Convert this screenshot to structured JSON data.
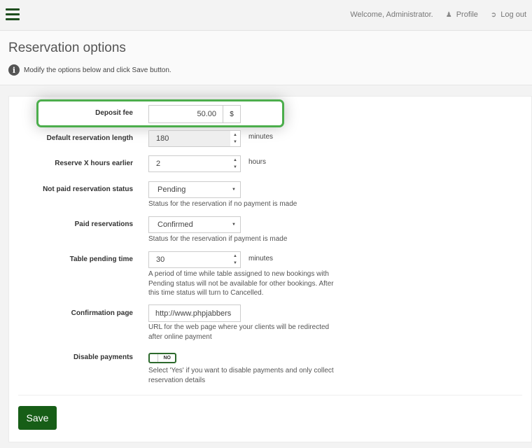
{
  "topbar": {
    "welcome": "Welcome, Administrator.",
    "profile": "Profile",
    "logout": "Log out"
  },
  "header": {
    "title": "Reservation options",
    "info": "Modify the options below and click Save button."
  },
  "form": {
    "deposit_fee": {
      "label": "Deposit fee",
      "value": "50.00",
      "addon": "$"
    },
    "default_length": {
      "label": "Default reservation length",
      "value": "180",
      "unit": "minutes"
    },
    "reserve_earlier": {
      "label": "Reserve X hours earlier",
      "value": "2",
      "unit": "hours"
    },
    "not_paid_status": {
      "label": "Not paid reservation status",
      "value": "Pending",
      "help": "Status for the reservation if no payment is made"
    },
    "paid_status": {
      "label": "Paid reservations",
      "value": "Confirmed",
      "help": "Status for the reservation if payment is made"
    },
    "pending_time": {
      "label": "Table pending time",
      "value": "30",
      "unit": "minutes",
      "help": "A period of time while table assigned to new bookings with Pending status will not be available for other bookings. After this time status will turn to Cancelled."
    },
    "confirmation_page": {
      "label": "Confirmation page",
      "value": "http://www.phpjabbers",
      "help": "URL for the web page where your clients will be redirected after online payment"
    },
    "disable_payments": {
      "label": "Disable payments",
      "toggle_text": "NO",
      "help": "Select 'Yes' if you want to disable payments and only collect reservation details"
    }
  },
  "actions": {
    "save_label": "Save"
  },
  "colors": {
    "accent": "#175e17",
    "highlight": "#4cae4c"
  },
  "icons": {
    "menu": "hamburger-icon",
    "profile": "user-icon",
    "logout": "logout-icon",
    "info": "info-icon"
  }
}
